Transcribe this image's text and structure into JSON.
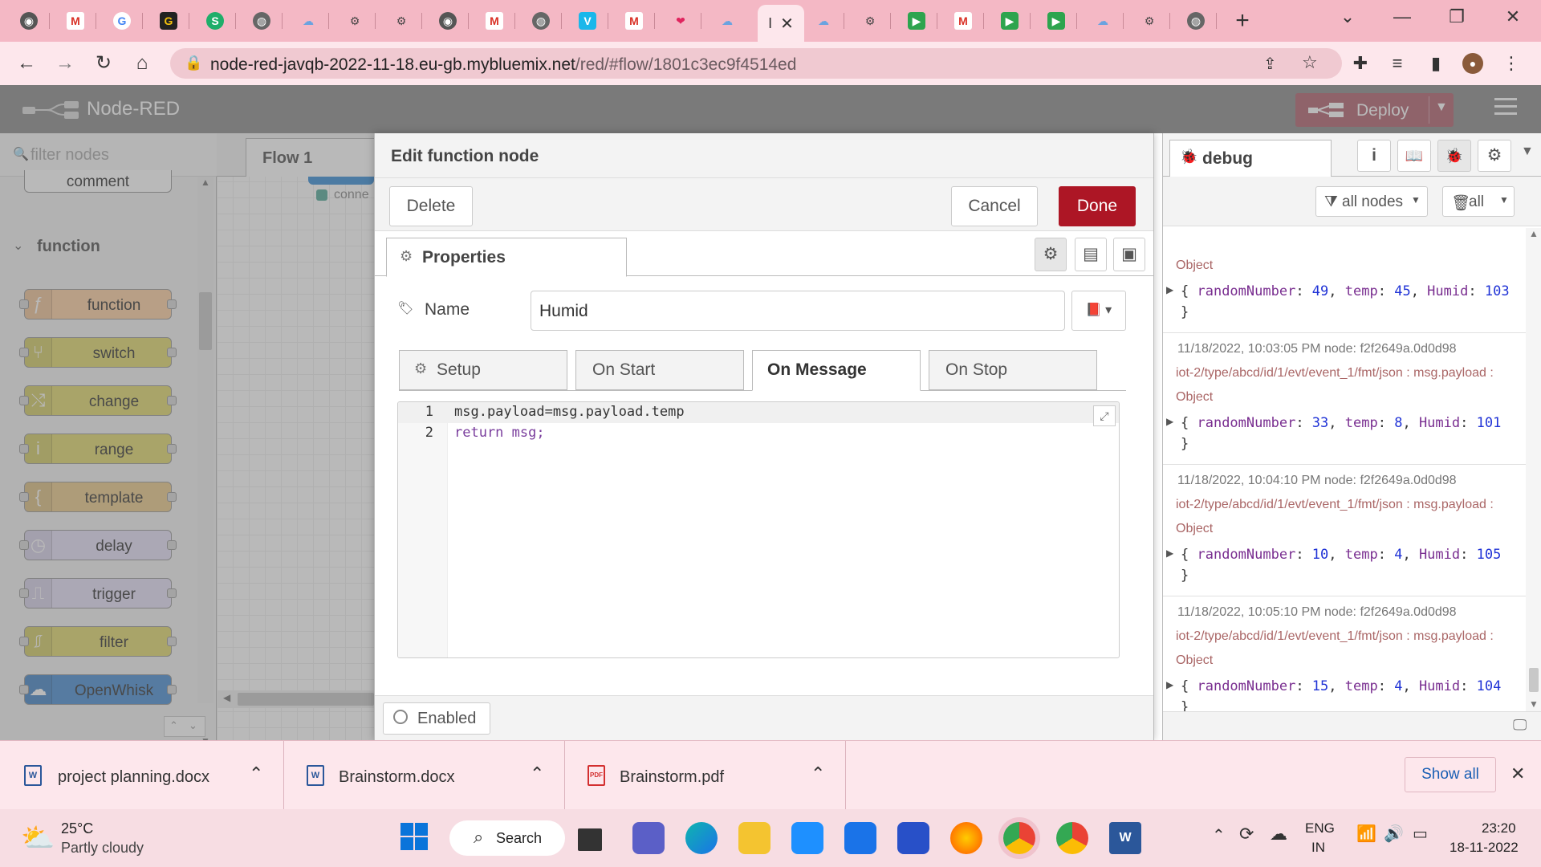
{
  "browser": {
    "url_host": "node-red-javqb-2022-11-18.eu-gb.mybluemix.net",
    "url_path": "/red/#flow/1801c3ec9f4514ed",
    "active_tab_label": "I",
    "new_tab": "+"
  },
  "nodered": {
    "brand": "Node-RED",
    "deploy_label": "Deploy"
  },
  "palette": {
    "filter_placeholder": "filter nodes",
    "partial_node": "comment",
    "category": "function",
    "nodes": [
      {
        "label": "function",
        "color": "#fdd0a2",
        "icon": "ƒ"
      },
      {
        "label": "switch",
        "color": "#e2d96e",
        "icon": "⑂"
      },
      {
        "label": "change",
        "color": "#e2d96e",
        "icon": "⤭"
      },
      {
        "label": "range",
        "color": "#e2d96e",
        "icon": "i"
      },
      {
        "label": "template",
        "color": "#ebcb8b",
        "icon": "{"
      },
      {
        "label": "delay",
        "color": "#e6e0f8",
        "icon": "◷"
      },
      {
        "label": "trigger",
        "color": "#e6e0f8",
        "icon": "⎍"
      },
      {
        "label": "filter",
        "color": "#e2d96e",
        "icon": "⎎"
      },
      {
        "label": "OpenWhisk",
        "color": "#4b8fd4",
        "icon": "☁"
      }
    ]
  },
  "workspace": {
    "tab_label": "Flow 1",
    "partial_node": "conne"
  },
  "editor": {
    "title": "Edit function node",
    "delete_label": "Delete",
    "cancel_label": "Cancel",
    "done_label": "Done",
    "properties_tab": "Properties",
    "name_label": "Name",
    "name_value": "Humid",
    "subtabs": [
      "Setup",
      "On Start",
      "On Message",
      "On Stop"
    ],
    "code_lines": [
      {
        "num": "1",
        "text": "msg.payload=msg.payload.temp"
      },
      {
        "num": "2",
        "text": "return msg;"
      }
    ],
    "enabled_label": "Enabled"
  },
  "debug": {
    "tab_label": "debug",
    "filter_nodes": "all nodes",
    "clear_all": "all",
    "entries": [
      {
        "meta": "",
        "topic": "",
        "object": "Object",
        "values": "{ randomNumber: 49, temp: 45, Humid: 103 }"
      },
      {
        "meta": "11/18/2022, 10:03:05 PM   node: f2f2649a.0d0d98",
        "topic": "iot-2/type/abcd/id/1/evt/event_1/fmt/json : msg.payload :",
        "object": "Object",
        "values": "{ randomNumber: 33, temp: 8, Humid: 101 }"
      },
      {
        "meta": "11/18/2022, 10:04:10 PM   node: f2f2649a.0d0d98",
        "topic": "iot-2/type/abcd/id/1/evt/event_1/fmt/json : msg.payload :",
        "object": "Object",
        "values": "{ randomNumber: 10, temp: 4, Humid: 105 }"
      },
      {
        "meta": "11/18/2022, 10:05:10 PM   node: f2f2649a.0d0d98",
        "topic": "iot-2/type/abcd/id/1/evt/event_1/fmt/json : msg.payload :",
        "object": "Object",
        "values": "{ randomNumber: 15, temp: 4, Humid: 104 }"
      }
    ]
  },
  "downloads": {
    "items": [
      "project planning.docx",
      "Brainstorm.docx",
      "Brainstorm.pdf"
    ],
    "show_all": "Show all"
  },
  "taskbar": {
    "weather_temp": "25°C",
    "weather_desc": "Partly cloudy",
    "search_label": "Search",
    "lang_top": "ENG",
    "lang_bottom": "IN",
    "time": "23:20",
    "date": "18-11-2022"
  }
}
